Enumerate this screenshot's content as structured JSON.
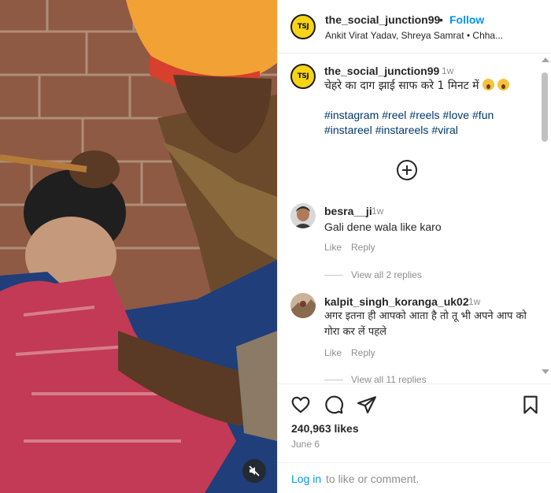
{
  "header": {
    "avatar_text": "TSJ",
    "username": "the_social_junction99",
    "separator": "•",
    "follow_label": "Follow",
    "subtitle": "Ankit Virat Yadav, Shreya Samrat • Chha..."
  },
  "caption": {
    "avatar_text": "TSJ",
    "username": "the_social_junction99",
    "time": "1w",
    "text": "चेहरे का दाग झाई साफ करे 1 मिनट में",
    "hashtags": [
      "#instagram",
      "#reel",
      "#reels",
      "#love",
      "#fun",
      "#instareel",
      "#instareels",
      "#viral"
    ]
  },
  "comments": [
    {
      "username": "besra__ji",
      "time": "1w",
      "text": "Gali dene wala like karo",
      "like_label": "Like",
      "reply_label": "Reply",
      "view_replies": "View all 2 replies"
    },
    {
      "username": "kalpit_singh_koranga_uk02",
      "time": "1w",
      "text": "अगर इतना ही आपको आता है तो तू भी अपने आप को गोरा कर लें पहले",
      "like_label": "Like",
      "reply_label": "Reply",
      "view_replies": "View all 11 replies"
    }
  ],
  "actions": {
    "likes": "240,963 likes",
    "date": "June 6",
    "icons": [
      "heart-icon",
      "comment-icon",
      "share-icon",
      "bookmark-icon"
    ]
  },
  "login": {
    "link": "Log in",
    "rest": "to like or comment."
  },
  "colors": {
    "accent": "#0095f6",
    "hashtag": "#00376b",
    "muted": "#8e8e8e",
    "text": "#262626",
    "brand_yellow": "#f7d416"
  }
}
